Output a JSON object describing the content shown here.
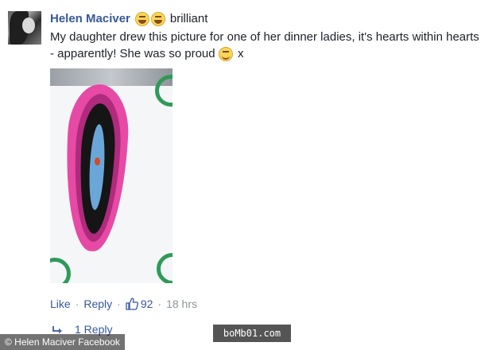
{
  "comment": {
    "author": "Helen Maciver",
    "suffix": "brilliant",
    "body": "My daughter drew this picture for one of her dinner ladies, it's hearts within hearts - apparently! She was so proud",
    "body_end": "x",
    "emojis": [
      "laughing-emoji",
      "laughing-emoji",
      "smiling-emoji"
    ]
  },
  "actions": {
    "like": "Like",
    "dot": "·",
    "reply": "Reply",
    "likes_count": "92",
    "time": "18 hrs"
  },
  "replies": {
    "label": "1 Reply"
  },
  "caption": "© Helen Maciver Facebook",
  "watermark": "boMb01.com",
  "colors": {
    "link": "#365899",
    "muted": "#90949c"
  }
}
